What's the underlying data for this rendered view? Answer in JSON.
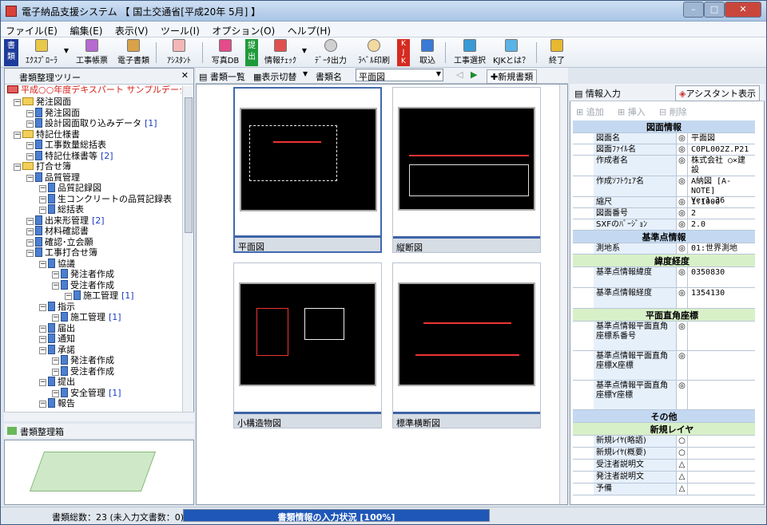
{
  "window": {
    "title": "電子納品支援システム 【 国土交通省[平成20年 5月] 】"
  },
  "menu": [
    "ファイル(E)",
    "編集(E)",
    "表示(V)",
    "ツール(I)",
    "オプション(O)",
    "ヘルプ(H)"
  ],
  "toolbar": {
    "shorui_label": "書類",
    "explorer": "ｴｸｽﾌﾟﾛｰﾗ",
    "koji_chohyo": "工事帳票",
    "denshi_shorui": "電子書類",
    "assistant": "ｱｼｽﾀﾝﾄ",
    "photo_db": "写真DB",
    "teishutsu_label": "提出",
    "info_check": "情報ﾁｪｯｸ",
    "data_output": "ﾃﾞｰﾀ出力",
    "label_print": "ﾗﾍﾞﾙ印刷",
    "torikomi": "取込",
    "koji_select": "工事選択",
    "kjk_about": "KJKとは？",
    "exit": "終了"
  },
  "left_panel": {
    "title": "書類整理ツリー",
    "root": "平成○○年度デキスパート サンプルデータ",
    "tree": [
      {
        "label": "発注図面",
        "type": "folder",
        "depth": 0
      },
      {
        "label": "発注図面",
        "type": "doc",
        "depth": 1
      },
      {
        "label": "設計図面取り込みデータ",
        "type": "doc",
        "depth": 1,
        "count": "[1]"
      },
      {
        "label": "特記仕様書",
        "type": "folder",
        "depth": 0
      },
      {
        "label": "工事数量総括表",
        "type": "doc",
        "depth": 1
      },
      {
        "label": "特記仕様書等",
        "type": "doc",
        "depth": 1,
        "count": "[2]"
      },
      {
        "label": "打合せ簿",
        "type": "folder",
        "depth": 0
      },
      {
        "label": "品質管理",
        "type": "doc",
        "depth": 1
      },
      {
        "label": "品質記録図",
        "type": "doc",
        "depth": 2
      },
      {
        "label": "生コンクリートの品質記録表",
        "type": "doc",
        "depth": 2
      },
      {
        "label": "総括表",
        "type": "doc",
        "depth": 2
      },
      {
        "label": "出来形管理",
        "type": "doc",
        "depth": 1,
        "count": "[2]"
      },
      {
        "label": "材料確認書",
        "type": "doc",
        "depth": 1
      },
      {
        "label": "確認･立会願",
        "type": "doc",
        "depth": 1
      },
      {
        "label": "工事打合せ簿",
        "type": "doc",
        "depth": 1
      },
      {
        "label": "協議",
        "type": "doc",
        "depth": 2
      },
      {
        "label": "発注者作成",
        "type": "doc",
        "depth": 3
      },
      {
        "label": "受注者作成",
        "type": "doc",
        "depth": 3
      },
      {
        "label": "施工管理",
        "type": "doc",
        "depth": 4,
        "count": "[1]"
      },
      {
        "label": "指示",
        "type": "doc",
        "depth": 2
      },
      {
        "label": "施工管理",
        "type": "doc",
        "depth": 3,
        "count": "[1]"
      },
      {
        "label": "届出",
        "type": "doc",
        "depth": 2
      },
      {
        "label": "通知",
        "type": "doc",
        "depth": 2
      },
      {
        "label": "承諾",
        "type": "doc",
        "depth": 2
      },
      {
        "label": "発注者作成",
        "type": "doc",
        "depth": 3
      },
      {
        "label": "受注者作成",
        "type": "doc",
        "depth": 3
      },
      {
        "label": "提出",
        "type": "doc",
        "depth": 2
      },
      {
        "label": "安全管理",
        "type": "doc",
        "depth": 3,
        "count": "[1]"
      },
      {
        "label": "報告",
        "type": "doc",
        "depth": 2
      }
    ],
    "box_title": "書類整理箱"
  },
  "center": {
    "btn_list": "書類一覧",
    "btn_toggle": "表示切替",
    "doc_name_label": "書類名",
    "doc_name_value": "平面図",
    "btn_new": "新規書類",
    "thumbs": [
      "平面図",
      "縦断図",
      "小構造物図",
      "標準横断図"
    ]
  },
  "right_panel": {
    "title": "情報入力",
    "assistant_btn": "アシスタント表示",
    "btn_add": "追加",
    "btn_insert": "挿入",
    "btn_delete": "削除",
    "sect_zumen": "図面情報",
    "rows1": [
      {
        "label": "図面名",
        "mark": "◎",
        "value": "平面図"
      },
      {
        "label": "図面ﾌｧｲﾙ名",
        "mark": "◎",
        "value": "C0PL002Z.P21"
      },
      {
        "label": "作成者名",
        "mark": "◎",
        "value": "株式会社 ○×建設"
      },
      {
        "label": "作成ｿﾌﾄｳｪｱ名",
        "mark": "◎",
        "value": "A納図 [A-NOTE] Ver1.36"
      },
      {
        "label": "縮尺",
        "mark": "◎",
        "value": "1:1000"
      },
      {
        "label": "図面番号",
        "mark": "◎",
        "value": "2"
      },
      {
        "label": "SXFのﾊﾞｰｼﾞｮﾝ",
        "mark": "◎",
        "value": "2.0"
      }
    ],
    "sect_kijun": "基準点情報",
    "row_sokuchi": {
      "label": "測地系",
      "mark": "◎",
      "value": "01:世界測地"
    },
    "sub_ido": "緯度経度",
    "rows_ido": [
      {
        "label": "基準点情報緯度",
        "mark": "◎",
        "value": "0350830"
      },
      {
        "label": "基準点情報経度",
        "mark": "◎",
        "value": "1354130"
      }
    ],
    "sub_heimen": "平面直角座標",
    "rows_heimen": [
      {
        "label": "基準点情報平面直角座標系番号",
        "mark": "◎",
        "value": ""
      },
      {
        "label": "基準点情報平面直角座標X座標",
        "mark": "◎",
        "value": ""
      },
      {
        "label": "基準点情報平面直角座標Y座標",
        "mark": "◎",
        "value": ""
      }
    ],
    "sect_other": "その他",
    "sub_layer": "新規レイヤ",
    "rows_layer": [
      {
        "label": "新規ﾚｲﾔ(略語)",
        "mark": "○",
        "value": ""
      },
      {
        "label": "新規ﾚｲﾔ(概要)",
        "mark": "○",
        "value": ""
      }
    ],
    "rows_misc": [
      {
        "label": "受注者説明文",
        "mark": "△",
        "value": ""
      },
      {
        "label": "発注者説明文",
        "mark": "△",
        "value": ""
      },
      {
        "label": "予備",
        "mark": "△",
        "value": ""
      }
    ]
  },
  "status": {
    "total": "書類総数：23 (未入力文書数：0)",
    "progress_label": "書類情報の入力状況 [100%]",
    "progress": 1.0
  },
  "colors": {
    "accent": "#3e64a6",
    "progress": "#1f57b8",
    "root_red": "#d4221b"
  }
}
